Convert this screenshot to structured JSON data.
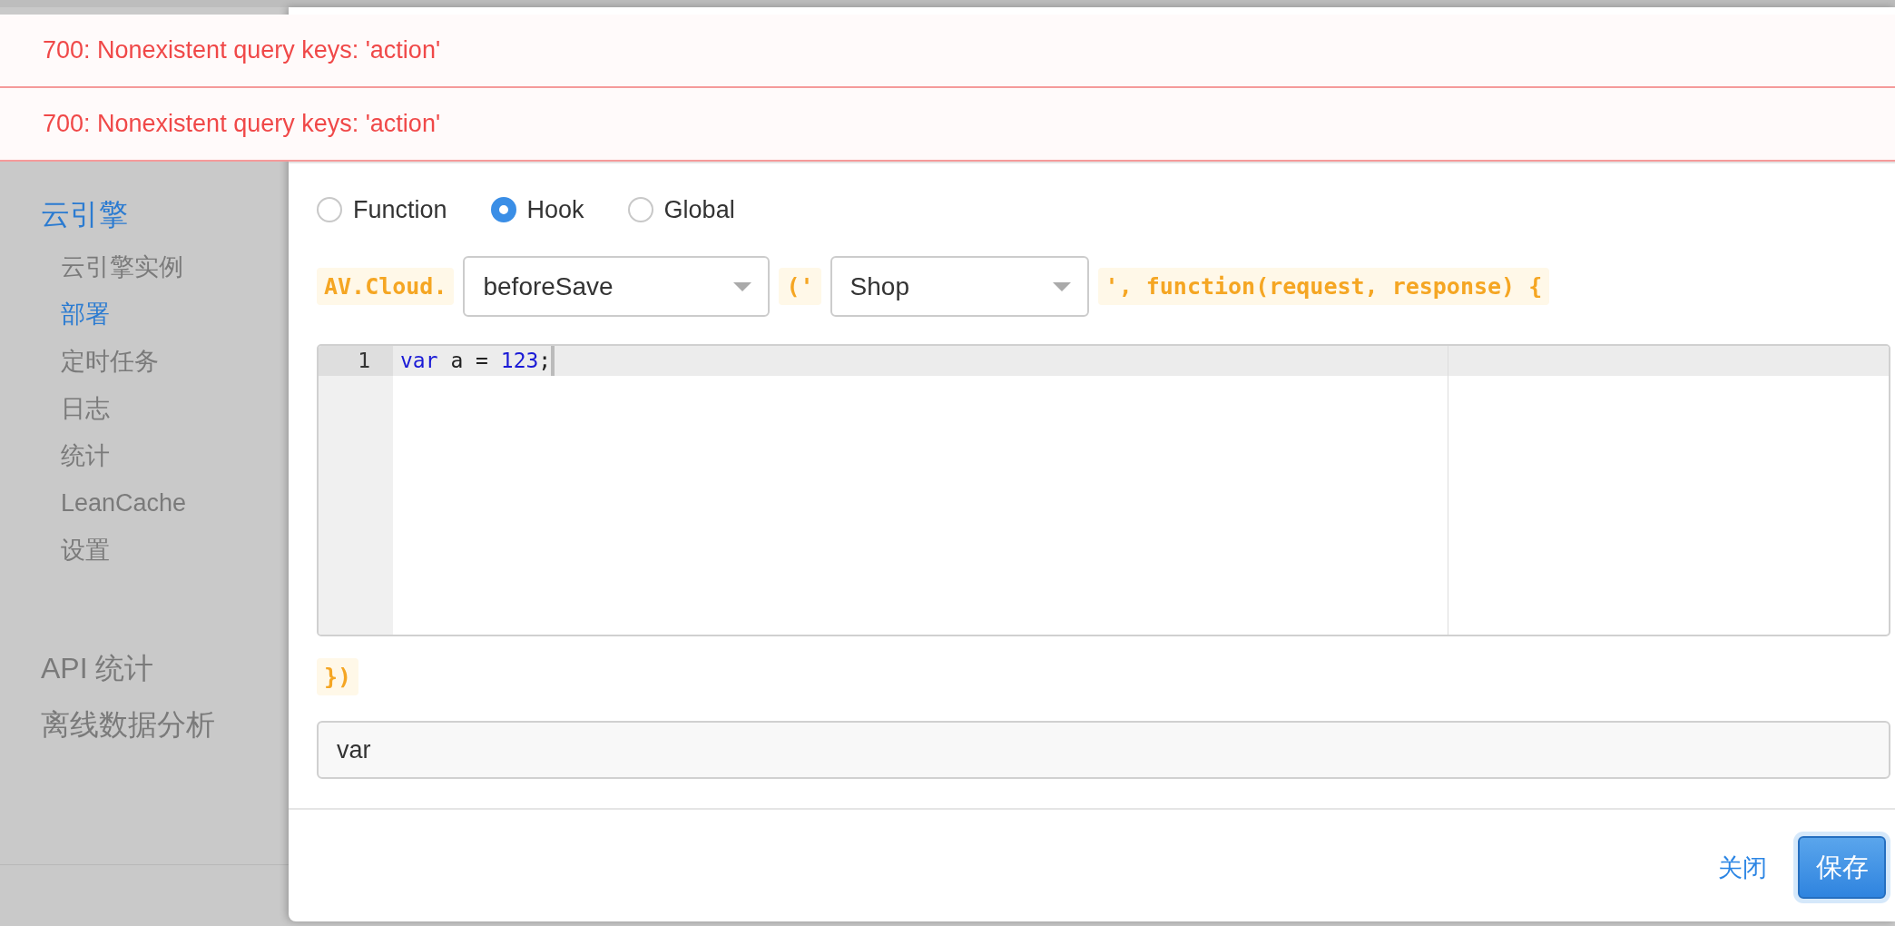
{
  "notifications": [
    {
      "text": "700: Nonexistent query keys: 'action'"
    },
    {
      "text": "700: Nonexistent query keys: 'action'"
    }
  ],
  "sidebar": {
    "sections": [
      {
        "label": "云引擎",
        "selected": true,
        "children": [
          {
            "label": "云引擎实例",
            "selected": false
          },
          {
            "label": "部署",
            "selected": true
          },
          {
            "label": "定时任务",
            "selected": false
          },
          {
            "label": "日志",
            "selected": false
          },
          {
            "label": "统计",
            "selected": false
          },
          {
            "label": "LeanCache",
            "selected": false
          },
          {
            "label": "设置",
            "selected": false
          }
        ]
      },
      {
        "label": "API 统计",
        "selected": false
      },
      {
        "label": "离线数据分析",
        "selected": false
      }
    ]
  },
  "dialog": {
    "function_types": [
      {
        "label": "Function",
        "selected": false
      },
      {
        "label": "Hook",
        "selected": true
      },
      {
        "label": "Global",
        "selected": false
      }
    ],
    "prefix": "AV.Cloud.",
    "hook_select": {
      "value": "beforeSave"
    },
    "open_paren": "('",
    "class_select": {
      "value": "Shop"
    },
    "suffix": "', function(request, response) {",
    "editor": {
      "lines": [
        {
          "number": "1",
          "active": true,
          "tokens": [
            {
              "text": "var",
              "kind": "keyword"
            },
            {
              "text": " a = ",
              "kind": "plain"
            },
            {
              "text": "123",
              "kind": "number"
            },
            {
              "text": ";",
              "kind": "plain"
            }
          ]
        }
      ]
    },
    "closing": "})",
    "output": {
      "value": "var"
    },
    "buttons": [
      {
        "label": "关闭",
        "kind": "link"
      },
      {
        "label": "保存",
        "kind": "primary"
      }
    ]
  }
}
